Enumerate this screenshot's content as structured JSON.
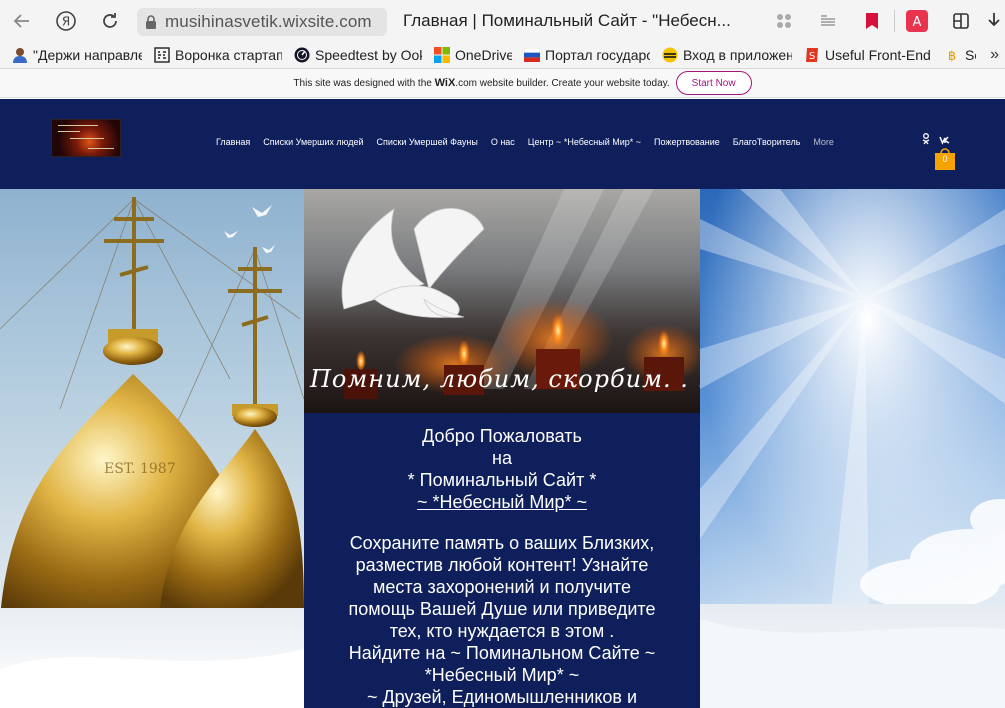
{
  "browser": {
    "url": "musihinasvetik.wixsite.com",
    "tab_title": "Главная | Поминальный Сайт - \"Небесн...",
    "bookmarks": [
      {
        "label": "\"Держи направле",
        "icon": "person-icon"
      },
      {
        "label": "Воронка стартап",
        "icon": "grid-icon"
      },
      {
        "label": "Speedtest by Ook",
        "icon": "speedtest-icon"
      },
      {
        "label": "OneDrive",
        "icon": "microsoft-icon"
      },
      {
        "label": "Портал государс",
        "icon": "flag-ru-icon"
      },
      {
        "label": "Вход в приложен",
        "icon": "bee-icon"
      },
      {
        "label": "Useful Front-End",
        "icon": "smashing-icon"
      },
      {
        "label": "Scr",
        "icon": "coin-icon"
      }
    ],
    "more_label": "»"
  },
  "wix_banner": {
    "text_before": "This site was designed with the ",
    "brand": "WiX",
    "text_after": ".com website builder. Create your website today.",
    "button": "Start Now"
  },
  "header": {
    "nav": [
      "Главная",
      "Списки Умерших людей",
      "Списки Умершей Фауны",
      "О нас",
      "Центр ~ *Небесный Мир* ~",
      "Пожертвование",
      "БлагоТворитель",
      "More"
    ],
    "cart_count": "0"
  },
  "hero": {
    "caption": "Помним, любим, скорбим. . .",
    "left_photo_text": "EST. 1987"
  },
  "content": {
    "lines": [
      "Добро Пожаловать",
      "на",
      "* Поминальный Сайт *",
      "~ *Небесный Мир* ~",
      "",
      "Сохраните память о ваших Близких,",
      "разместив любой контент! Узнайте",
      "места захоронений и получите",
      "помощь Вашей Душе или приведите",
      "тех, кто нуждается в этом .",
      "Найдите на ~ Поминальном Сайте ~",
      "*Небесный Мир* ~",
      "~ Друзей, Единомышленников и"
    ]
  },
  "colors": {
    "navy": "#0e1f5c",
    "wix_accent": "#a0167b",
    "cart": "#f5a300"
  }
}
